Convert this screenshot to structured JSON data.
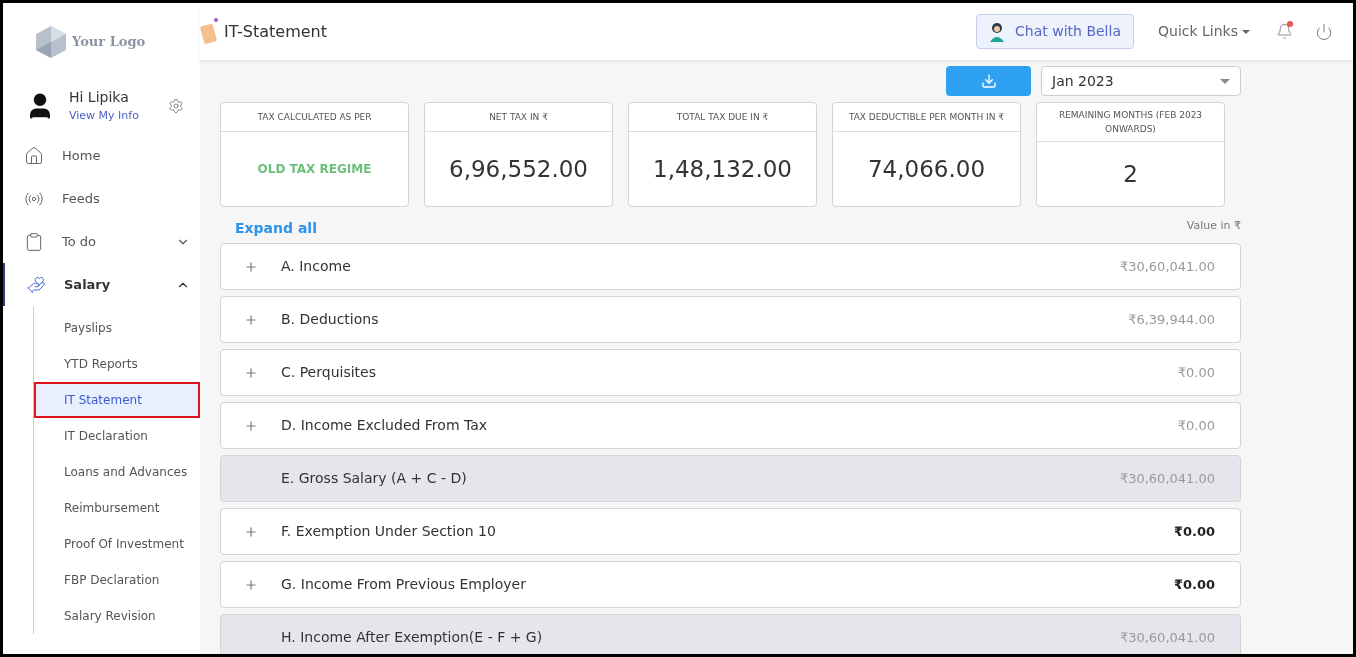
{
  "logo": {
    "text": "Your Logo"
  },
  "user": {
    "greeting": "Hi Lipika",
    "link": "View My Info"
  },
  "nav": [
    {
      "label": "Home",
      "selected": false
    },
    {
      "label": "Feeds",
      "selected": false
    },
    {
      "label": "To do",
      "expanded": false,
      "selected": false
    },
    {
      "label": "Salary",
      "expanded": true,
      "selected": true,
      "children": [
        {
          "label": "Payslips",
          "selected": false
        },
        {
          "label": "YTD Reports",
          "selected": false
        },
        {
          "label": "IT Statement",
          "selected": true
        },
        {
          "label": "IT Declaration",
          "selected": false
        },
        {
          "label": "Loans and Advances",
          "selected": false
        },
        {
          "label": "Reimbursement",
          "selected": false
        },
        {
          "label": "Proof Of Investment",
          "selected": false
        },
        {
          "label": "FBP Declaration",
          "selected": false
        },
        {
          "label": "Salary Revision",
          "selected": false
        }
      ]
    }
  ],
  "header": {
    "title": "IT-Statement",
    "chat_button": "Chat with Bella",
    "quick_links": "Quick Links",
    "notification_unread": true
  },
  "month_select": {
    "value": "Jan 2023"
  },
  "cards": [
    {
      "label": "TAX CALCULATED AS PER",
      "value": "OLD TAX REGIME",
      "kind": "status"
    },
    {
      "label": "NET TAX IN ₹",
      "value": "6,96,552.00",
      "kind": "number"
    },
    {
      "label": "TOTAL TAX DUE IN ₹",
      "value": "1,48,132.00",
      "kind": "number"
    },
    {
      "label": "TAX DEDUCTIBLE PER MONTH IN ₹",
      "value": "74,066.00",
      "kind": "number"
    },
    {
      "label": "REMAINING MONTHS (FEB 2023 ONWARDS)",
      "value": "2",
      "kind": "number"
    }
  ],
  "expand_all": "Expand all",
  "value_note": "Value in ₹",
  "rows": [
    {
      "label": "A. Income",
      "amount": "₹30,60,041.00",
      "kind": "section",
      "bold_amount": false
    },
    {
      "label": "B. Deductions",
      "amount": "₹6,39,944.00",
      "kind": "section",
      "bold_amount": false
    },
    {
      "label": "C. Perquisites",
      "amount": "₹0.00",
      "kind": "section",
      "bold_amount": false
    },
    {
      "label": "D. Income Excluded From Tax",
      "amount": "₹0.00",
      "kind": "section",
      "bold_amount": false
    },
    {
      "label": "E. Gross Salary (A + C - D)",
      "amount": "₹30,60,041.00",
      "kind": "total",
      "bold_amount": false
    },
    {
      "label": "F. Exemption Under Section 10",
      "amount": "₹0.00",
      "kind": "section",
      "bold_amount": true
    },
    {
      "label": "G. Income From Previous Employer",
      "amount": "₹0.00",
      "kind": "section",
      "bold_amount": true
    },
    {
      "label": "H. Income After Exemption(E - F + G)",
      "amount": "₹30,60,041.00",
      "kind": "total",
      "bold_amount": false
    }
  ]
}
